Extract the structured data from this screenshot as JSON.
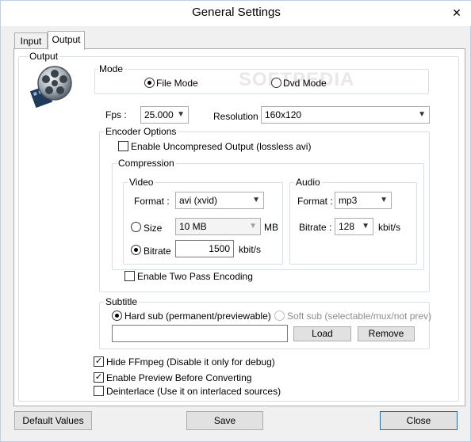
{
  "window": {
    "title": "General Settings",
    "close_glyph": "✕"
  },
  "tabs": [
    {
      "label": "Input",
      "active": false
    },
    {
      "label": "Output",
      "active": true
    }
  ],
  "output_group": {
    "label": "Output",
    "icon": "film-reel-icon"
  },
  "mode": {
    "label": "Mode",
    "file_mode": {
      "label": "File Mode",
      "selected": true
    },
    "dvd_mode": {
      "label": "Dvd Mode",
      "selected": false
    }
  },
  "watermark": "SOFTPEDIA",
  "fps": {
    "label": "Fps :",
    "value": "25.000"
  },
  "resolution": {
    "label": "Resolution :",
    "value": "160x120"
  },
  "encoder_options": {
    "label": "Encoder Options",
    "uncompressed": {
      "label": "Enable Uncompresed Output (lossless avi)",
      "checked": false
    },
    "compression": {
      "label": "Compression",
      "video": {
        "label": "Video",
        "format_label": "Format :",
        "format_value": "avi (xvid)",
        "size": {
          "label": "Size",
          "selected": false,
          "value": "10 MB",
          "unit": "MB"
        },
        "bitrate": {
          "label": "Bitrate",
          "selected": true,
          "value": "1500",
          "unit": "kbit/s"
        }
      },
      "audio": {
        "label": "Audio",
        "format_label": "Format :",
        "format_value": "mp3",
        "bitrate_label": "Bitrate :",
        "bitrate_value": "128",
        "bitrate_unit": "kbit/s"
      }
    },
    "two_pass": {
      "label": "Enable Two Pass Encoding",
      "checked": false
    }
  },
  "subtitle": {
    "label": "Subtitle",
    "hard_sub": {
      "label": "Hard sub (permanent/previewable)",
      "selected": true
    },
    "soft_sub": {
      "label": "Soft sub (selectable/mux/not prev)",
      "selected": false
    },
    "path_value": "",
    "load_label": "Load",
    "remove_label": "Remove"
  },
  "options": {
    "hide_ffmpeg": {
      "label": "Hide FFmpeg (Disable it only for debug)",
      "checked": true
    },
    "enable_preview": {
      "label": "Enable Preview Before Converting",
      "checked": true
    },
    "deinterlace": {
      "label": "Deinterlace (Use it on interlaced sources)",
      "checked": false
    }
  },
  "footer": {
    "default_values_label": "Default Values",
    "save_label": "Save",
    "close_label": "Close"
  },
  "check_glyph": "✓"
}
